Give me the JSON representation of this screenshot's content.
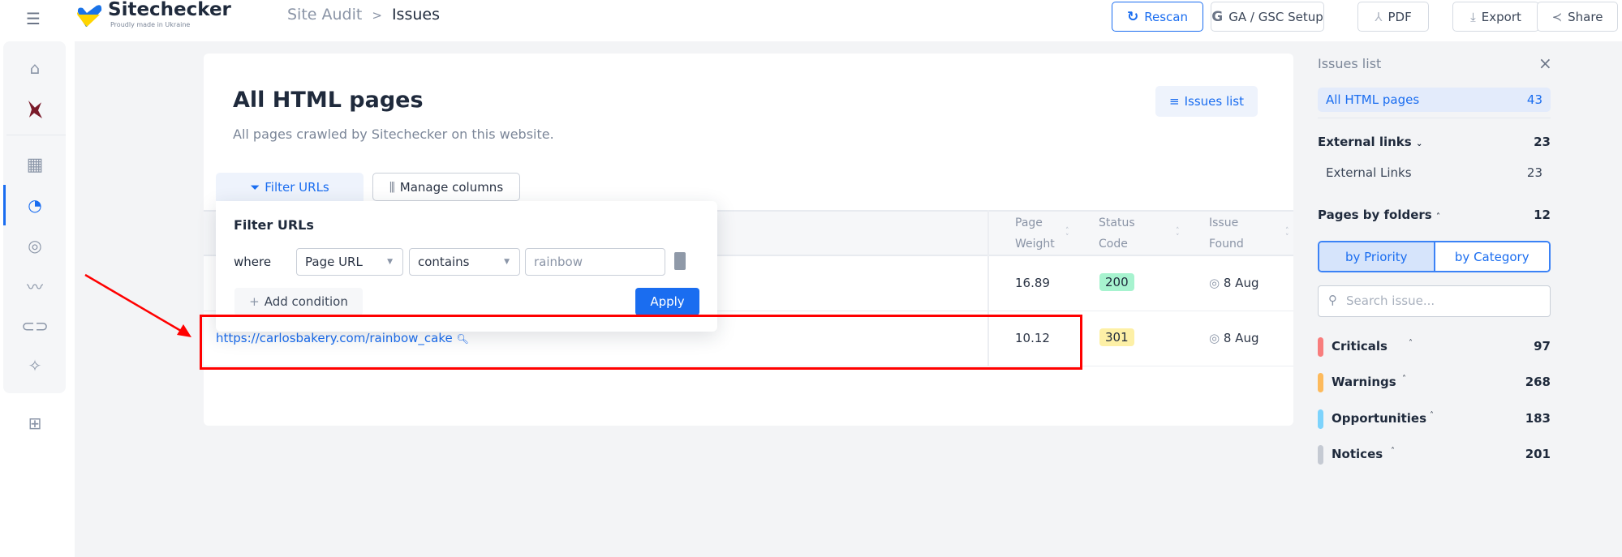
{
  "header": {
    "logo_title": "Sitechecker",
    "logo_subtitle": "Proudly made in Ukraine",
    "breadcrumb": {
      "parent": "Site Audit",
      "separator": ">",
      "current": "Issues"
    },
    "buttons": {
      "rescan": "Rescan",
      "ga_gsc": "GA / GSC Setup",
      "pdf": "PDF",
      "export": "Export",
      "share": "Share"
    }
  },
  "sidebar": {
    "active": "dashboard",
    "icons": [
      "home-icon",
      "project-favicon",
      "table-icon",
      "dashboard-gauge-icon",
      "radar-icon",
      "trend-icon",
      "link-icon",
      "magic-wand-icon",
      "add-widget-icon"
    ]
  },
  "main": {
    "title": "All HTML pages",
    "subtitle": "All pages crawled by Sitechecker on this website.",
    "issues_list_button": "Issues list",
    "filter_button": "Filter URLs",
    "manage_columns_button": "Manage columns",
    "columns": [
      {
        "line1": "Page",
        "line2": "Weight"
      },
      {
        "line1": "Status",
        "line2": "Code"
      },
      {
        "line1": "Issue",
        "line2": "Found"
      }
    ],
    "rows": [
      {
        "url": "",
        "page_weight": "16.89",
        "status_code": "200",
        "issue_found": "8 Aug"
      },
      {
        "url": "https://carlosbakery.com/rainbow_cake",
        "page_weight": "10.12",
        "status_code": "301",
        "issue_found": "8 Aug"
      }
    ],
    "status_colors": {
      "200": "#a7f3cf",
      "301": "#fdf0a6"
    }
  },
  "filter_popup": {
    "title": "Filter URLs",
    "where_label": "where",
    "field": "Page URL",
    "operator": "contains",
    "value": "rainbow",
    "add_condition": "Add condition",
    "apply": "Apply"
  },
  "issues_panel": {
    "title": "Issues list",
    "all_pages": {
      "label": "All HTML pages",
      "count": "43"
    },
    "external_links": {
      "label": "External links",
      "count": "23",
      "sub_label": "External Links",
      "sub_count": "23"
    },
    "pages_by_folders": {
      "label": "Pages by folders",
      "count": "12"
    },
    "tabs": [
      "by Priority",
      "by Category"
    ],
    "active_tab": "by Priority",
    "search_placeholder": "Search issue...",
    "priorities": [
      {
        "label": "Criticals",
        "count": "97",
        "color": "#f87d7d"
      },
      {
        "label": "Warnings",
        "count": "268",
        "color": "#fdba5c"
      },
      {
        "label": "Opportunities",
        "count": "183",
        "color": "#7dd3fc"
      },
      {
        "label": "Notices",
        "count": "201",
        "color": "#c5cad3"
      }
    ]
  },
  "annotation": {
    "color": "#ff0000"
  }
}
